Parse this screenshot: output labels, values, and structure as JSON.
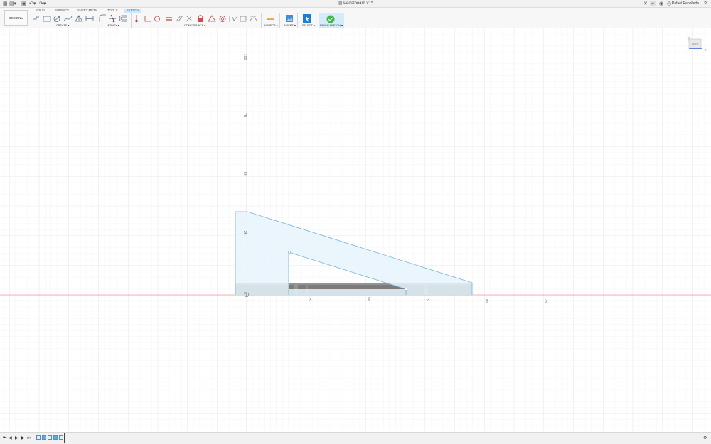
{
  "titlebar": {
    "doc_title": "Pedalboard v1*",
    "user_name": "Rafael Rebolleda",
    "icons": [
      "grid-icon",
      "file-icon",
      "save-icon",
      "undo-icon",
      "redo-icon",
      "close-tab-icon",
      "new-tab-icon",
      "extensions-icon",
      "job-status-icon",
      "notifications-icon",
      "help-icon"
    ]
  },
  "ribbon": {
    "workspace": "DESIGN ▸",
    "tabs": [
      "SOLID",
      "SURFACE",
      "SHEET METAL",
      "TOOLS",
      "SKETCH"
    ],
    "active_tab": "SKETCH",
    "groups": {
      "create": "CREATE ▾",
      "modify": "MODIFY ▾",
      "constraints": "CONSTRAINTS ▾",
      "inspect": "INSPECT ▾",
      "insert": "INSERT ▾",
      "select": "SELECT ▾",
      "finish": "FINISH SKETCH ▾"
    }
  },
  "viewport": {
    "view_cube_label": "LEFT",
    "axis_label_z": "Z",
    "vertical_ruler": [
      "100",
      "75",
      "50",
      "25",
      "0"
    ],
    "horizontal_ruler": [
      "25",
      "50",
      "75",
      "100",
      "125"
    ]
  },
  "colors": {
    "sketch_line": "#6fb6d6",
    "sketch_fill": "#e8f3fb",
    "body": "#7b7b7b",
    "active_tab": "#1a6fb3",
    "finish_button": "#3fb94a",
    "axis_red": "#ee6b6b"
  },
  "timeline": {
    "controls": [
      "first-icon",
      "prev-icon",
      "play-icon",
      "next-icon",
      "last-icon"
    ],
    "items": [
      "sketch",
      "body",
      "sketch",
      "body",
      "sketch"
    ]
  }
}
